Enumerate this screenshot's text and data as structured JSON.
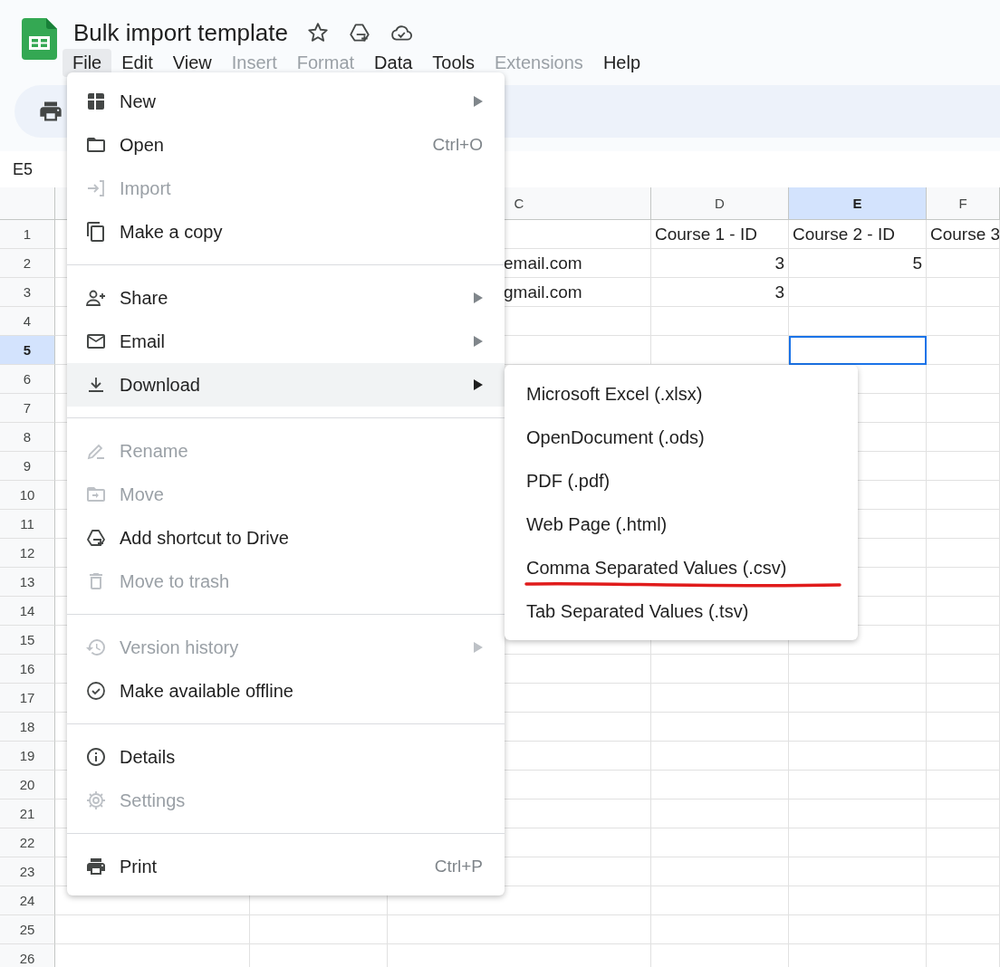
{
  "document": {
    "title": "Bulk import template"
  },
  "menu_bar": [
    {
      "label": "File",
      "selected": true,
      "disabled": false
    },
    {
      "label": "Edit",
      "selected": false,
      "disabled": false
    },
    {
      "label": "View",
      "selected": false,
      "disabled": false
    },
    {
      "label": "Insert",
      "selected": false,
      "disabled": true
    },
    {
      "label": "Format",
      "selected": false,
      "disabled": true
    },
    {
      "label": "Data",
      "selected": false,
      "disabled": false
    },
    {
      "label": "Tools",
      "selected": false,
      "disabled": false
    },
    {
      "label": "Extensions",
      "selected": false,
      "disabled": true
    },
    {
      "label": "Help",
      "selected": false,
      "disabled": false
    }
  ],
  "name_box": "E5",
  "sheet": {
    "column_headers": [
      {
        "label": "C",
        "selected": false
      },
      {
        "label": "D",
        "selected": false
      },
      {
        "label": "E",
        "selected": true
      },
      {
        "label": "F",
        "selected": false
      }
    ],
    "rows": [
      {
        "number": "1",
        "selected": false,
        "cells": {
          "col_d": "Course 1 - ID",
          "col_e": "Course 2 - ID",
          "col_f": "Course 3"
        }
      },
      {
        "number": "2",
        "selected": false,
        "cells": {
          "col_c": "email.com",
          "col_d": "3",
          "col_e": "5"
        }
      },
      {
        "number": "3",
        "selected": false,
        "cells": {
          "col_c": "gmail.com",
          "col_d": "3"
        }
      },
      {
        "number": "4",
        "selected": false,
        "cells": {}
      },
      {
        "number": "5",
        "selected": true,
        "cells": {}
      },
      {
        "number": "6",
        "selected": false,
        "cells": {}
      },
      {
        "number": "7",
        "selected": false,
        "cells": {}
      },
      {
        "number": "8",
        "selected": false,
        "cells": {}
      },
      {
        "number": "9",
        "selected": false,
        "cells": {}
      },
      {
        "number": "10",
        "selected": false,
        "cells": {}
      },
      {
        "number": "11",
        "selected": false,
        "cells": {}
      },
      {
        "number": "12",
        "selected": false,
        "cells": {}
      },
      {
        "number": "13",
        "selected": false,
        "cells": {}
      },
      {
        "number": "14",
        "selected": false,
        "cells": {}
      },
      {
        "number": "15",
        "selected": false,
        "cells": {}
      },
      {
        "number": "16",
        "selected": false,
        "cells": {}
      },
      {
        "number": "17",
        "selected": false,
        "cells": {}
      },
      {
        "number": "18",
        "selected": false,
        "cells": {}
      },
      {
        "number": "19",
        "selected": false,
        "cells": {}
      },
      {
        "number": "20",
        "selected": false,
        "cells": {}
      },
      {
        "number": "21",
        "selected": false,
        "cells": {}
      },
      {
        "number": "22",
        "selected": false,
        "cells": {}
      },
      {
        "number": "23",
        "selected": false,
        "cells": {}
      },
      {
        "number": "24",
        "selected": false,
        "cells": {}
      },
      {
        "number": "25",
        "selected": false,
        "cells": {}
      },
      {
        "number": "26",
        "selected": false,
        "cells": {}
      }
    ]
  },
  "file_menu": [
    {
      "kind": "item",
      "label": "New",
      "submenu": true,
      "disabled": false,
      "selected": false
    },
    {
      "kind": "item",
      "label": "Open",
      "shortcut": "Ctrl+O",
      "submenu": false,
      "disabled": false,
      "selected": false
    },
    {
      "kind": "item",
      "label": "Import",
      "submenu": false,
      "disabled": true,
      "selected": false
    },
    {
      "kind": "item",
      "label": "Make a copy",
      "submenu": false,
      "disabled": false,
      "selected": false
    },
    {
      "kind": "divider"
    },
    {
      "kind": "item",
      "label": "Share",
      "submenu": true,
      "disabled": false,
      "selected": false
    },
    {
      "kind": "item",
      "label": "Email",
      "submenu": true,
      "disabled": false,
      "selected": false
    },
    {
      "kind": "item",
      "label": "Download",
      "submenu": true,
      "disabled": false,
      "selected": true
    },
    {
      "kind": "divider"
    },
    {
      "kind": "item",
      "label": "Rename",
      "submenu": false,
      "disabled": true,
      "selected": false
    },
    {
      "kind": "item",
      "label": "Move",
      "submenu": false,
      "disabled": true,
      "selected": false
    },
    {
      "kind": "item",
      "label": "Add shortcut to Drive",
      "submenu": false,
      "disabled": false,
      "selected": false
    },
    {
      "kind": "item",
      "label": "Move to trash",
      "submenu": false,
      "disabled": true,
      "selected": false
    },
    {
      "kind": "divider"
    },
    {
      "kind": "item",
      "label": "Version history",
      "submenu": true,
      "disabled": true,
      "selected": false
    },
    {
      "kind": "item",
      "label": "Make available offline",
      "submenu": false,
      "disabled": false,
      "selected": false
    },
    {
      "kind": "divider"
    },
    {
      "kind": "item",
      "label": "Details",
      "submenu": false,
      "disabled": false,
      "selected": false
    },
    {
      "kind": "item",
      "label": "Settings",
      "submenu": false,
      "disabled": true,
      "selected": false
    },
    {
      "kind": "divider"
    },
    {
      "kind": "item",
      "label": "Print",
      "shortcut": "Ctrl+P",
      "submenu": false,
      "disabled": false,
      "selected": false
    }
  ],
  "download_submenu": [
    {
      "label": "Microsoft Excel (.xlsx)",
      "underlined": false
    },
    {
      "label": "OpenDocument (.ods)",
      "underlined": false
    },
    {
      "label": "PDF (.pdf)",
      "underlined": false
    },
    {
      "label": "Web Page (.html)",
      "underlined": false
    },
    {
      "label": "Comma Separated Values (.csv)",
      "underlined": true
    },
    {
      "label": "Tab Separated Values (.tsv)",
      "underlined": false
    }
  ]
}
